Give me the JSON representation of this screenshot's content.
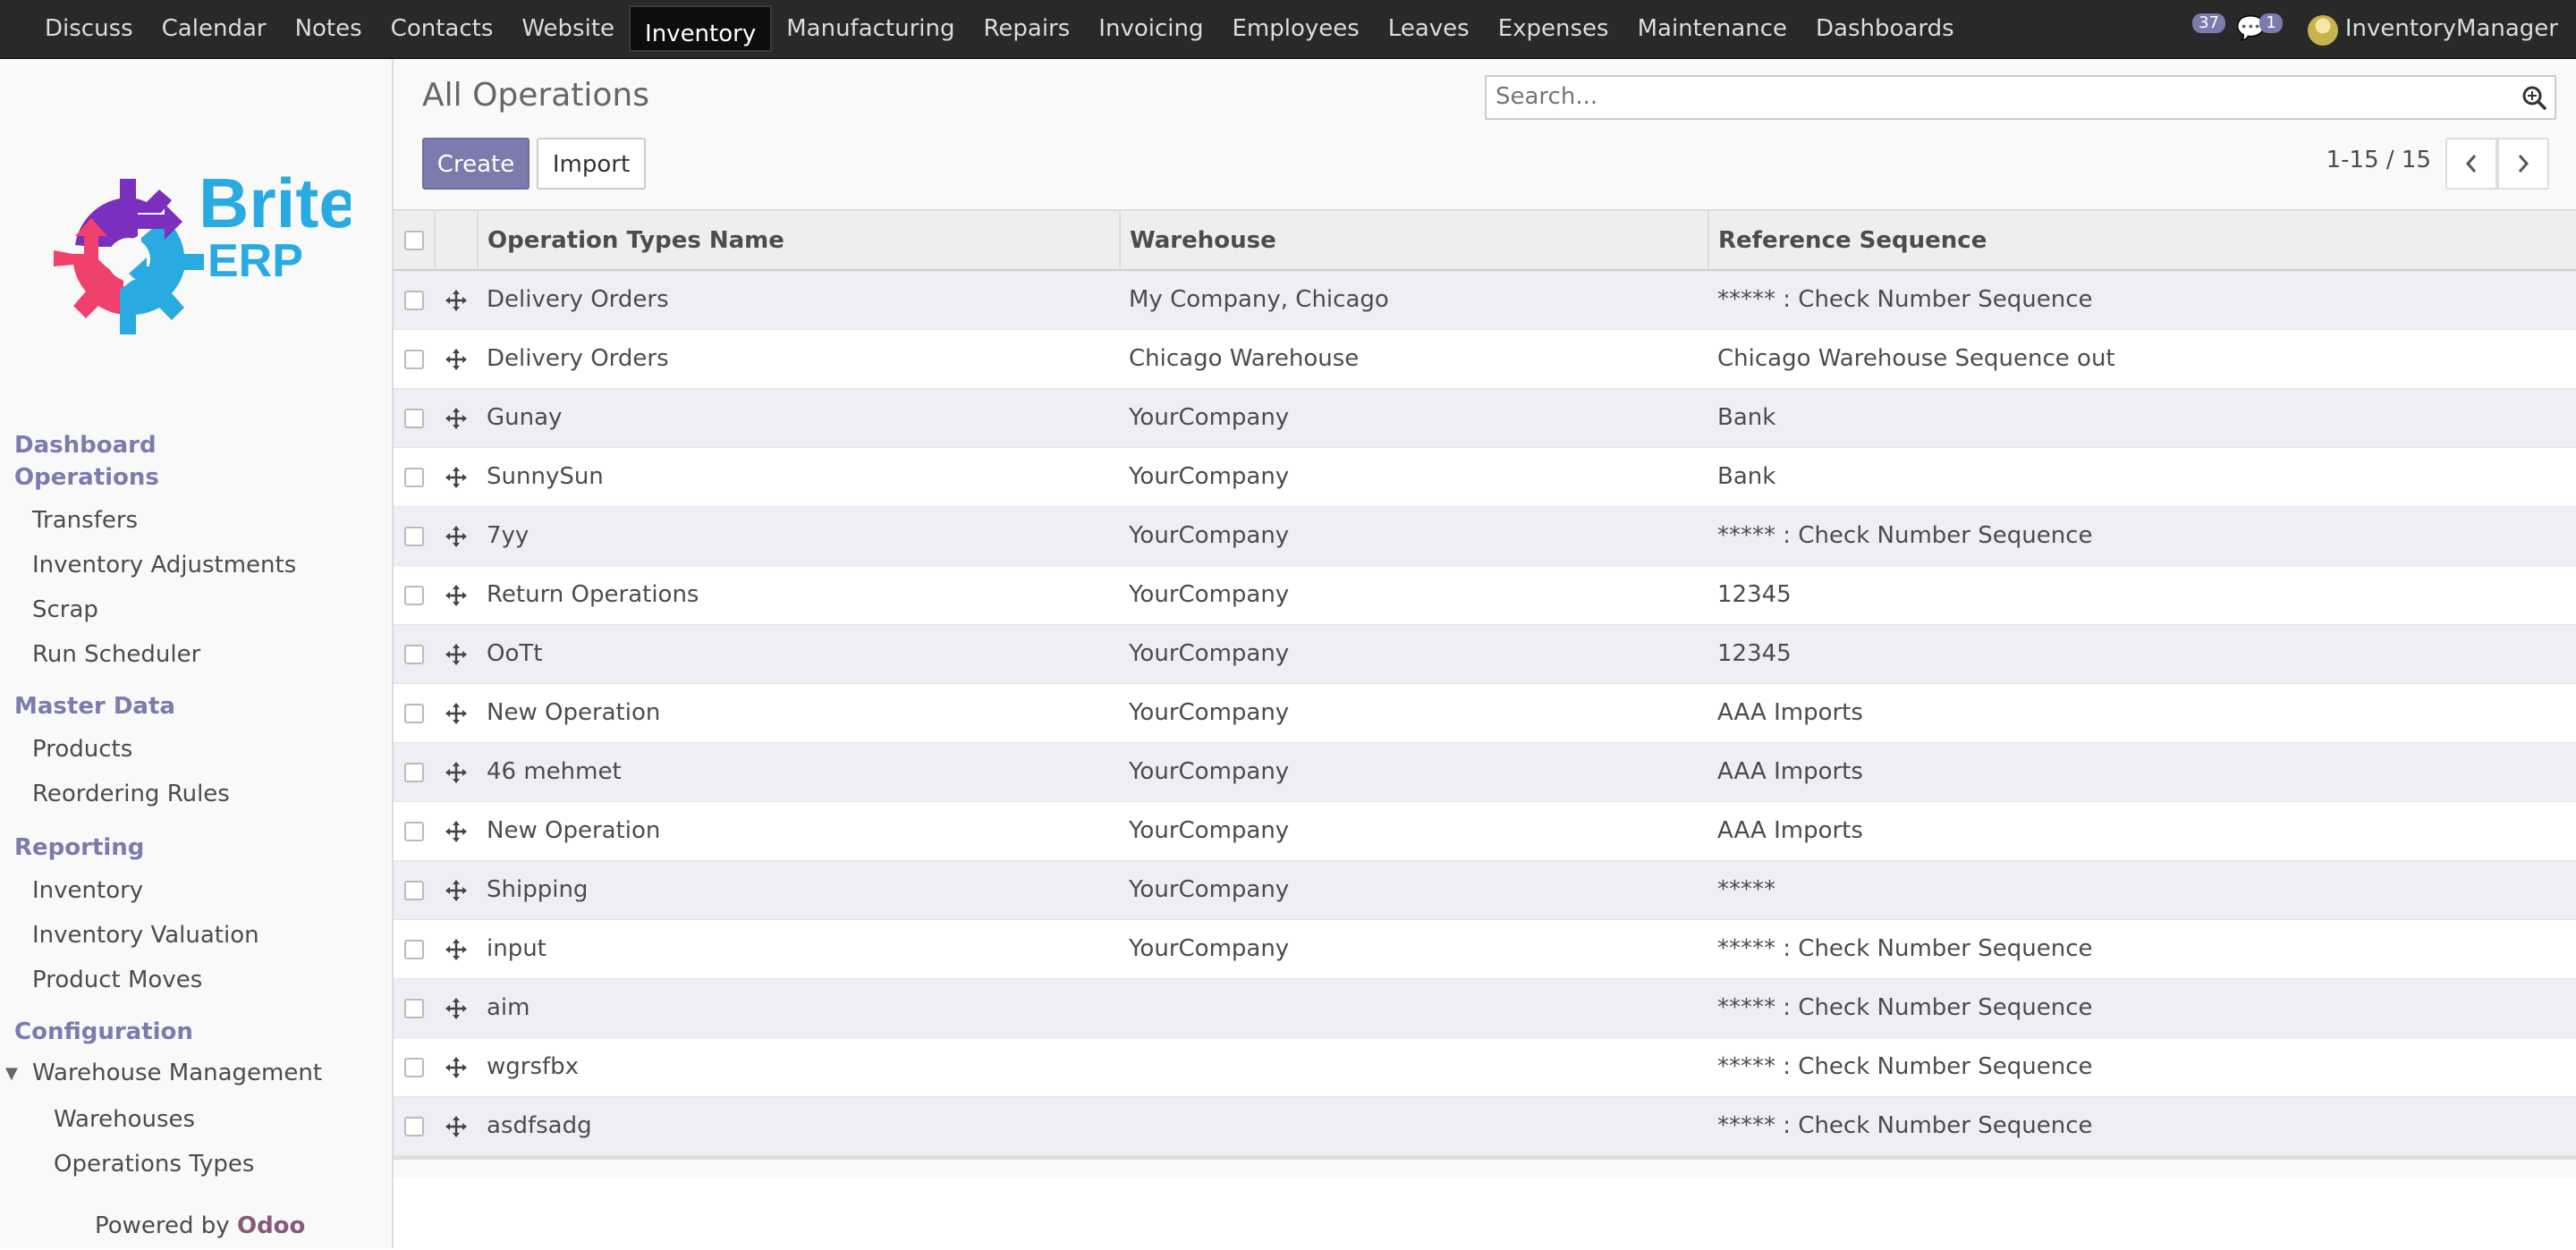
{
  "topnav": {
    "items": [
      "Discuss",
      "Calendar",
      "Notes",
      "Contacts",
      "Website",
      "Inventory",
      "Manufacturing",
      "Repairs",
      "Invoicing",
      "Employees",
      "Leaves",
      "Expenses",
      "Maintenance",
      "Dashboards"
    ],
    "active": "Inventory",
    "messages_count": "37",
    "chat_count": "1",
    "user_name": "InventoryManager"
  },
  "sidebar": {
    "logo_text_brite": "Brite",
    "logo_text_erp": "ERP",
    "section_dashboard": "Dashboard",
    "section_operations": "Operations",
    "operations_items": [
      "Transfers",
      "Inventory Adjustments",
      "Scrap",
      "Run Scheduler"
    ],
    "section_master_data": "Master Data",
    "master_items": [
      "Products",
      "Reordering Rules"
    ],
    "section_reporting": "Reporting",
    "reporting_items": [
      "Inventory",
      "Inventory Valuation",
      "Product Moves"
    ],
    "section_configuration": "Configuration",
    "config_group": "Warehouse Management",
    "config_items": [
      "Warehouses",
      "Operations Types"
    ],
    "powered_by": "Powered by ",
    "powered_brand": "Odoo"
  },
  "control": {
    "title": "All Operations",
    "search_placeholder": "Search...",
    "create_label": "Create",
    "import_label": "Import",
    "pager": "1-15 / 15"
  },
  "table": {
    "headers": [
      "Operation Types Name",
      "Warehouse",
      "Reference Sequence"
    ],
    "rows": [
      [
        "Delivery Orders",
        "My Company, Chicago",
        "***** : Check Number Sequence"
      ],
      [
        "Delivery Orders",
        "Chicago Warehouse",
        "Chicago Warehouse Sequence out"
      ],
      [
        "Gunay",
        "YourCompany",
        "Bank"
      ],
      [
        "SunnySun",
        "YourCompany",
        "Bank"
      ],
      [
        "7yy",
        "YourCompany",
        "***** : Check Number Sequence"
      ],
      [
        "Return Operations",
        "YourCompany",
        "12345"
      ],
      [
        "OoTt",
        "YourCompany",
        "12345"
      ],
      [
        "New Operation",
        "YourCompany",
        "AAA Imports"
      ],
      [
        "46 mehmet",
        "YourCompany",
        "AAA Imports"
      ],
      [
        "New Operation",
        "YourCompany",
        "AAA Imports"
      ],
      [
        "Shipping",
        "YourCompany",
        "*****"
      ],
      [
        "input",
        "YourCompany",
        "***** : Check Number Sequence"
      ],
      [
        "aim",
        "",
        "***** : Check Number Sequence"
      ],
      [
        "wgrsfbx",
        "",
        "***** : Check Number Sequence"
      ],
      [
        "asdfsadg",
        "",
        "***** : Check Number Sequence"
      ]
    ]
  },
  "colors": {
    "topbar": "#292929",
    "accent": "#7c7bad",
    "odoo_brand": "#875a7b",
    "row_alt": "#eeeef6"
  },
  "icons": [
    "search-icon",
    "chevron-left-icon",
    "chevron-right-icon",
    "drag-handle-icon",
    "chat-icon",
    "caret-down-icon"
  ]
}
